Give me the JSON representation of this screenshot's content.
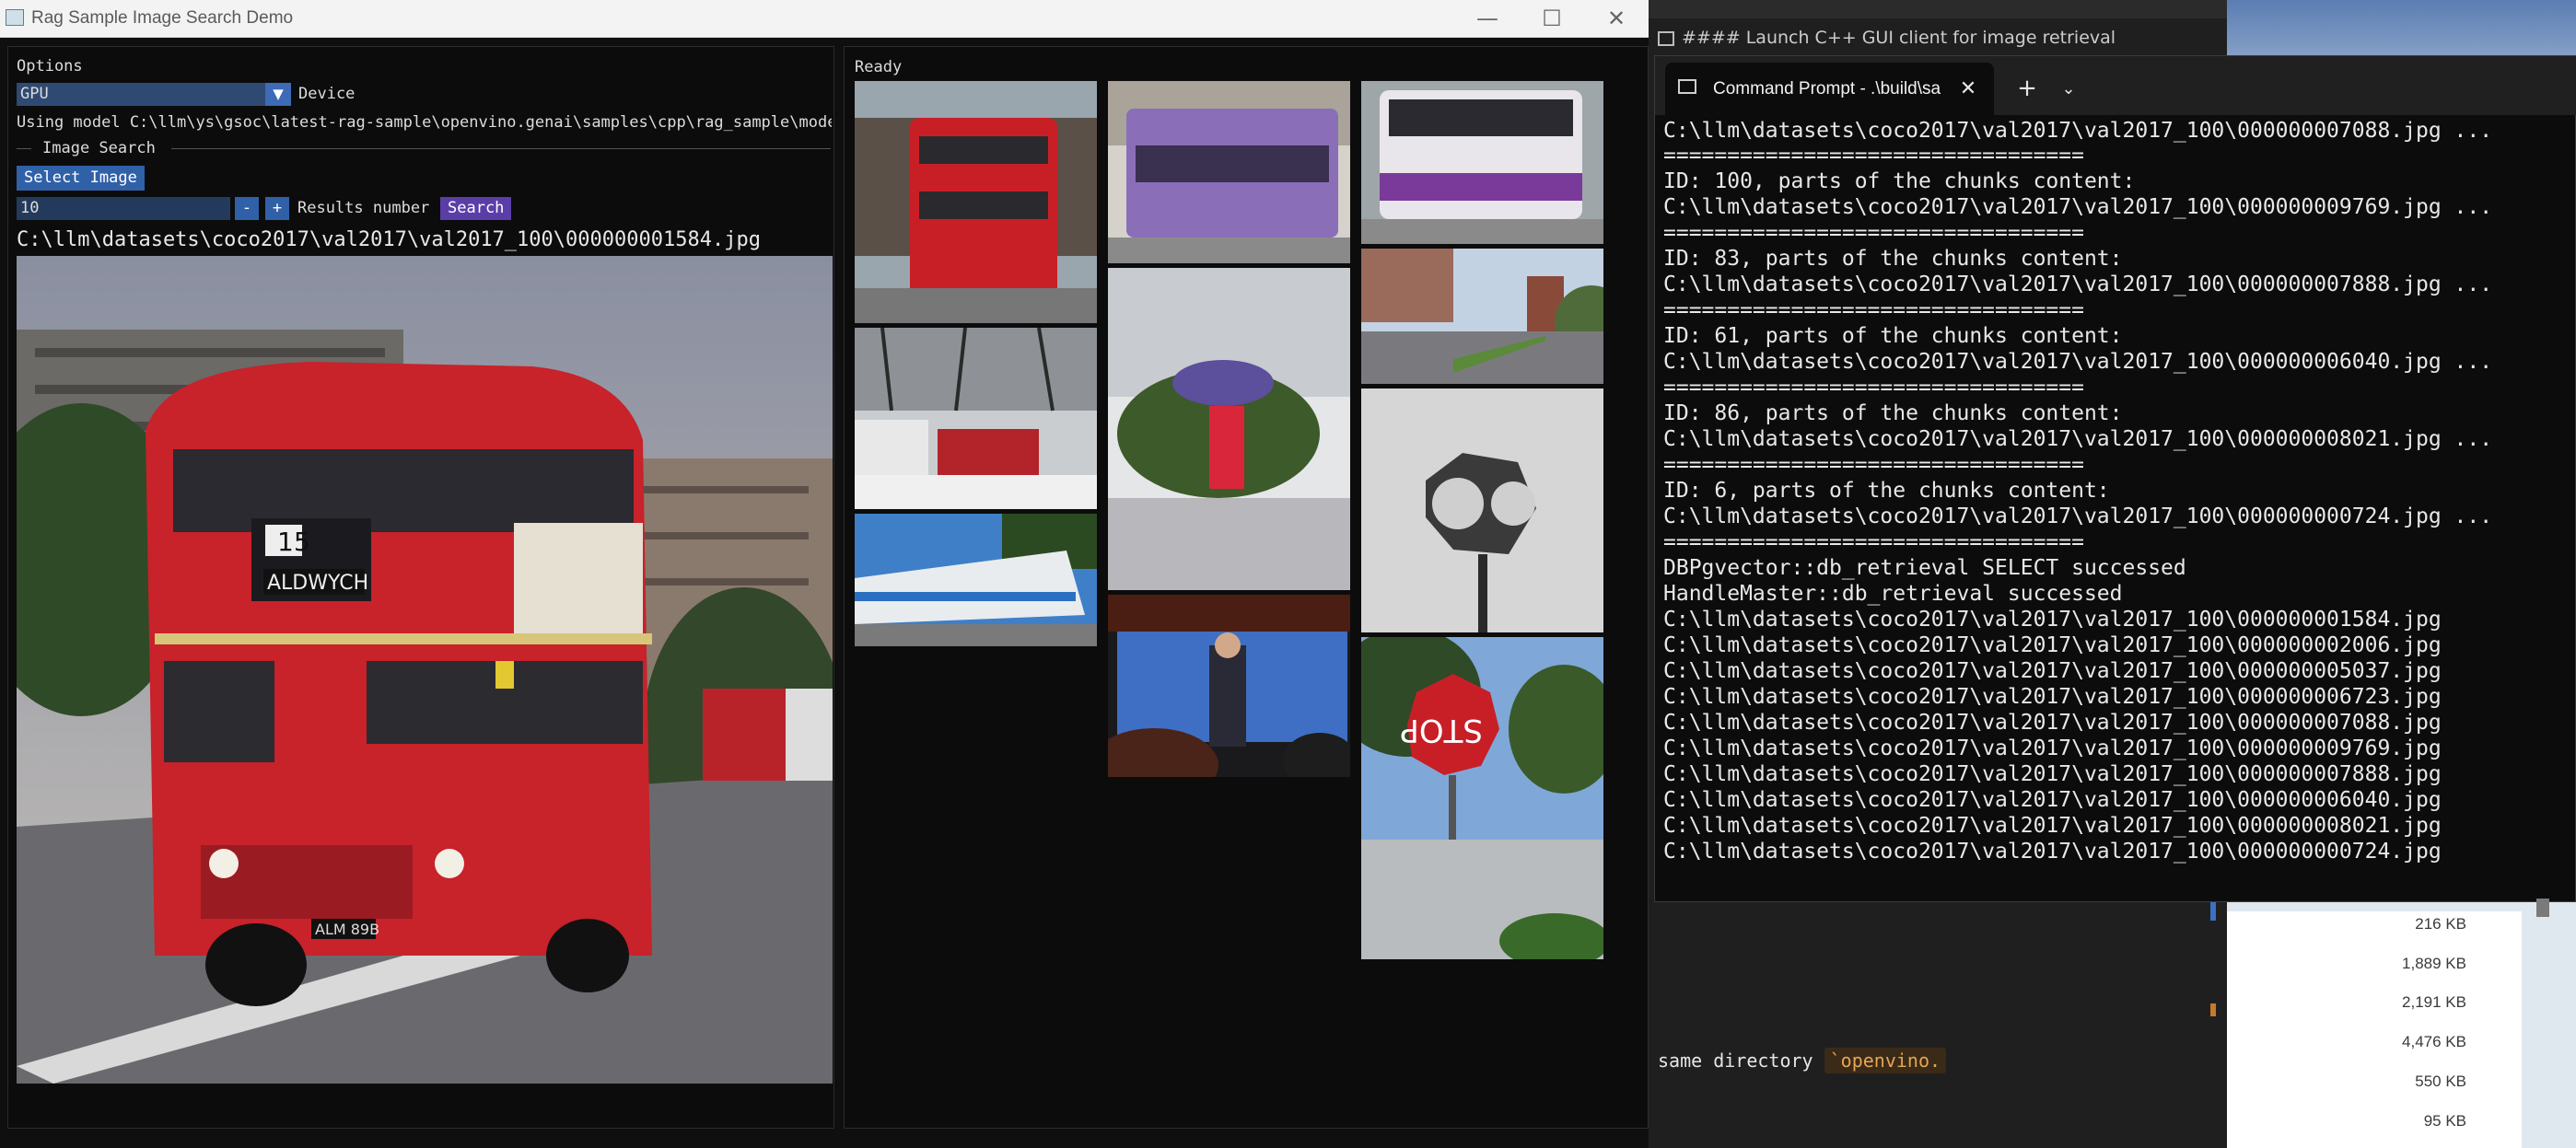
{
  "app": {
    "title": "Rag Sample Image Search Demo",
    "window_buttons": {
      "minimize": "—",
      "maximize": "☐",
      "close": "✕"
    }
  },
  "options": {
    "header": "Options",
    "device_value": "GPU",
    "device_label": "Device",
    "model_line": "Using model C:\\llm\\ys\\gsoc\\latest-rag-sample\\openvino.genai\\samples\\cpp\\rag_sample\\models",
    "section_title": "Image Search",
    "select_image_label": "Select Image",
    "results_value": "10",
    "minus_label": "-",
    "plus_label": "+",
    "results_label": "Results number",
    "search_label": "Search",
    "selected_path": "C:\\llm\\datasets\\coco2017\\val2017\\val2017_100\\000000001584.jpg"
  },
  "results": {
    "status": "Ready"
  },
  "terminal": {
    "tab_title": "Command Prompt - .\\build\\sa",
    "close": "✕",
    "plus": "+",
    "chevron": "⌄",
    "lines": [
      "C:\\llm\\datasets\\coco2017\\val2017\\val2017_100\\000000007088.jpg ...",
      "=================================",
      "ID: 100, parts of the chunks content:",
      "C:\\llm\\datasets\\coco2017\\val2017\\val2017_100\\000000009769.jpg ...",
      "=================================",
      "ID: 83, parts of the chunks content:",
      "C:\\llm\\datasets\\coco2017\\val2017\\val2017_100\\000000007888.jpg ...",
      "=================================",
      "ID: 61, parts of the chunks content:",
      "C:\\llm\\datasets\\coco2017\\val2017\\val2017_100\\000000006040.jpg ...",
      "=================================",
      "ID: 86, parts of the chunks content:",
      "C:\\llm\\datasets\\coco2017\\val2017\\val2017_100\\000000008021.jpg ...",
      "=================================",
      "ID: 6, parts of the chunks content:",
      "C:\\llm\\datasets\\coco2017\\val2017\\val2017_100\\000000000724.jpg ...",
      "=================================",
      "DBPgvector::db_retrieval SELECT successed",
      "HandleMaster::db_retrieval successed",
      "C:\\llm\\datasets\\coco2017\\val2017\\val2017_100\\000000001584.jpg",
      "C:\\llm\\datasets\\coco2017\\val2017\\val2017_100\\000000002006.jpg",
      "C:\\llm\\datasets\\coco2017\\val2017\\val2017_100\\000000005037.jpg",
      "C:\\llm\\datasets\\coco2017\\val2017\\val2017_100\\000000006723.jpg",
      "C:\\llm\\datasets\\coco2017\\val2017\\val2017_100\\000000007088.jpg",
      "C:\\llm\\datasets\\coco2017\\val2017\\val2017_100\\000000009769.jpg",
      "C:\\llm\\datasets\\coco2017\\val2017\\val2017_100\\000000007888.jpg",
      "C:\\llm\\datasets\\coco2017\\val2017\\val2017_100\\000000006040.jpg",
      "C:\\llm\\datasets\\coco2017\\val2017\\val2017_100\\000000008021.jpg",
      "C:\\llm\\datasets\\coco2017\\val2017\\val2017_100\\000000000724.jpg"
    ]
  },
  "background": {
    "editor_heading": "#### Launch C++ GUI client for image retrieval",
    "code_text": "same directory ",
    "code_chip": "`openvino.",
    "file_sizes": [
      "216 KB",
      "1,889 KB",
      "2,191 KB",
      "4,476 KB",
      "550 KB",
      "95 KB"
    ]
  }
}
